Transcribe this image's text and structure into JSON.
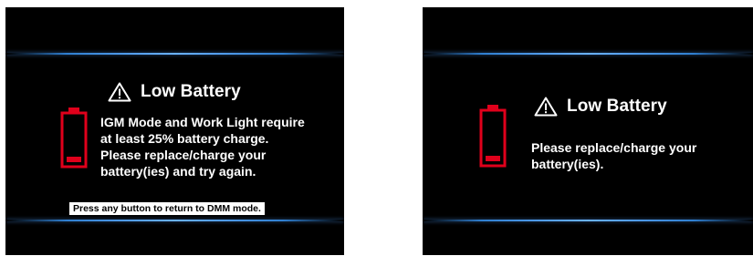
{
  "left_screen": {
    "title": "Low Battery",
    "icons": {
      "warning": "warning-triangle-icon",
      "battery": "battery-low-icon"
    },
    "message_lines": [
      "IGM Mode and Work Light require",
      "at least 25% battery charge.",
      "Please replace/charge your",
      "battery(ies) and try again."
    ],
    "footer_banner": "Press any button to return to DMM mode."
  },
  "right_screen": {
    "title": "Low Battery",
    "icons": {
      "warning": "warning-triangle-icon",
      "battery": "battery-low-icon"
    },
    "message_lines": [
      "Please replace/charge your",
      "battery(ies)."
    ]
  },
  "colors": {
    "screen_background": "#000000",
    "accent_line": "#4a9be8",
    "battery_red": "#e0001b",
    "text": "#ffffff"
  }
}
